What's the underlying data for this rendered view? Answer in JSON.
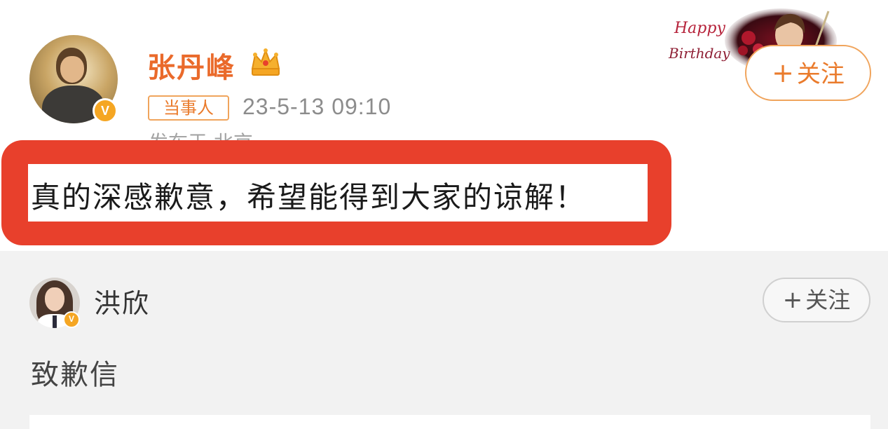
{
  "main_post": {
    "username": "张丹峰",
    "tag": "当事人",
    "timestamp": "23-5-13 09:10",
    "location": "发布于 北京",
    "text": "真的深感歉意，希望能得到大家的谅解！",
    "follow_label": "关注",
    "follow_plus": "+",
    "decoration": {
      "line1": "Happy",
      "line2": "Birthday"
    }
  },
  "repost": {
    "username": "洪欣",
    "text": "致歉信",
    "follow_label": "关注",
    "follow_plus": "+"
  },
  "badge_glyph": "V",
  "colors": {
    "accent_orange": "#ea6a2b",
    "follow_border": "#f0a45c",
    "highlight_red": "#e8402c",
    "verified_gold": "#f5a623",
    "repost_bg": "#f2f2f2"
  },
  "icons": {
    "crown": "crown-icon",
    "verified": "verified-badge-icon",
    "plus": "plus-icon"
  }
}
